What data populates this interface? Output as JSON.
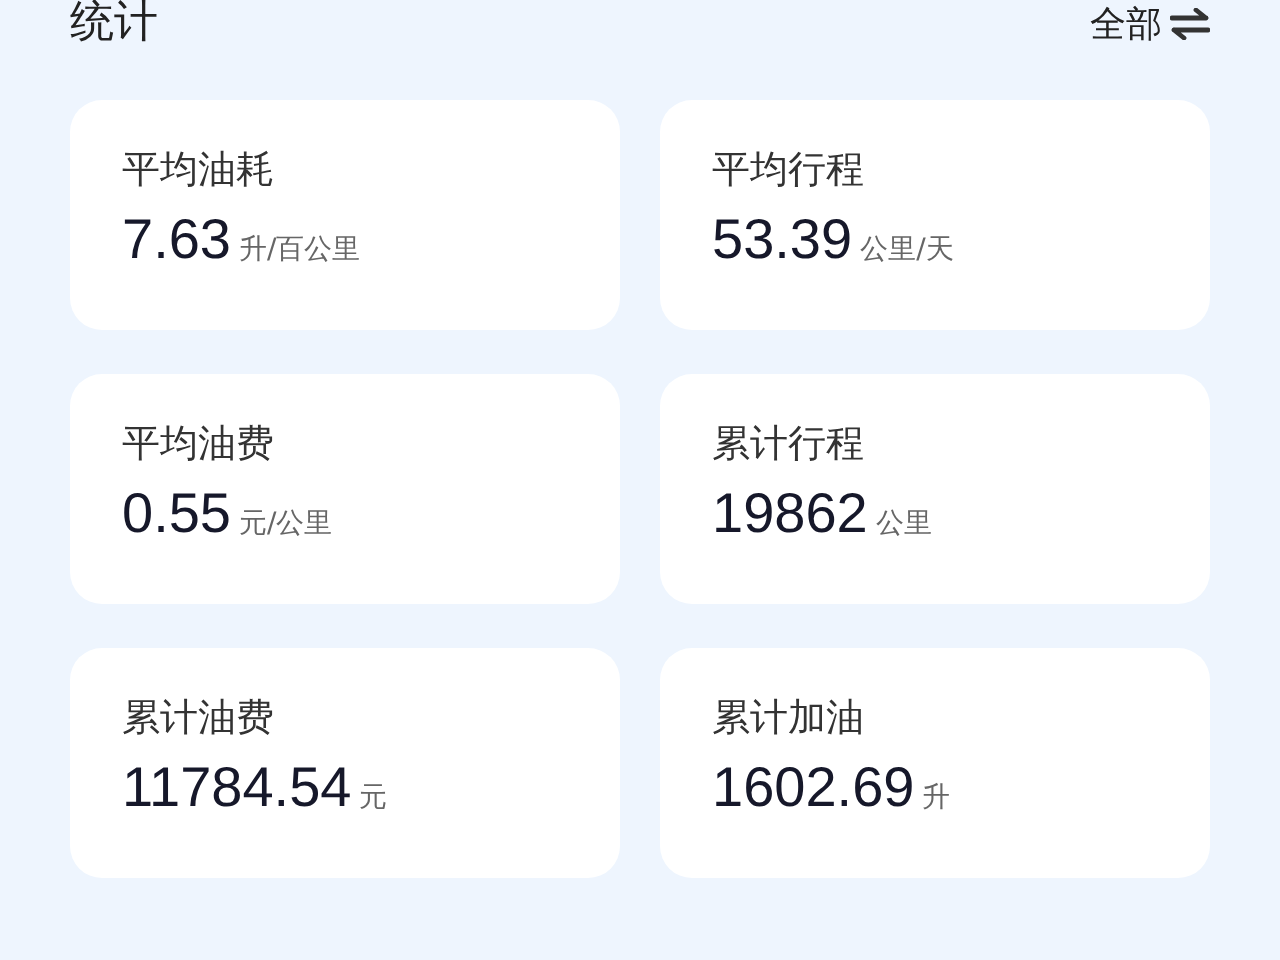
{
  "header": {
    "title": "统计",
    "filter": "全部"
  },
  "stats": [
    {
      "label": "平均油耗",
      "value": "7.63",
      "unit": "升/百公里"
    },
    {
      "label": "平均行程",
      "value": "53.39",
      "unit": "公里/天"
    },
    {
      "label": "平均油费",
      "value": "0.55",
      "unit": "元/公里"
    },
    {
      "label": "累计行程",
      "value": "19862",
      "unit": "公里"
    },
    {
      "label": "累计油费",
      "value": "11784.54",
      "unit": "元"
    },
    {
      "label": "累计加油",
      "value": "1602.69",
      "unit": "升"
    }
  ]
}
